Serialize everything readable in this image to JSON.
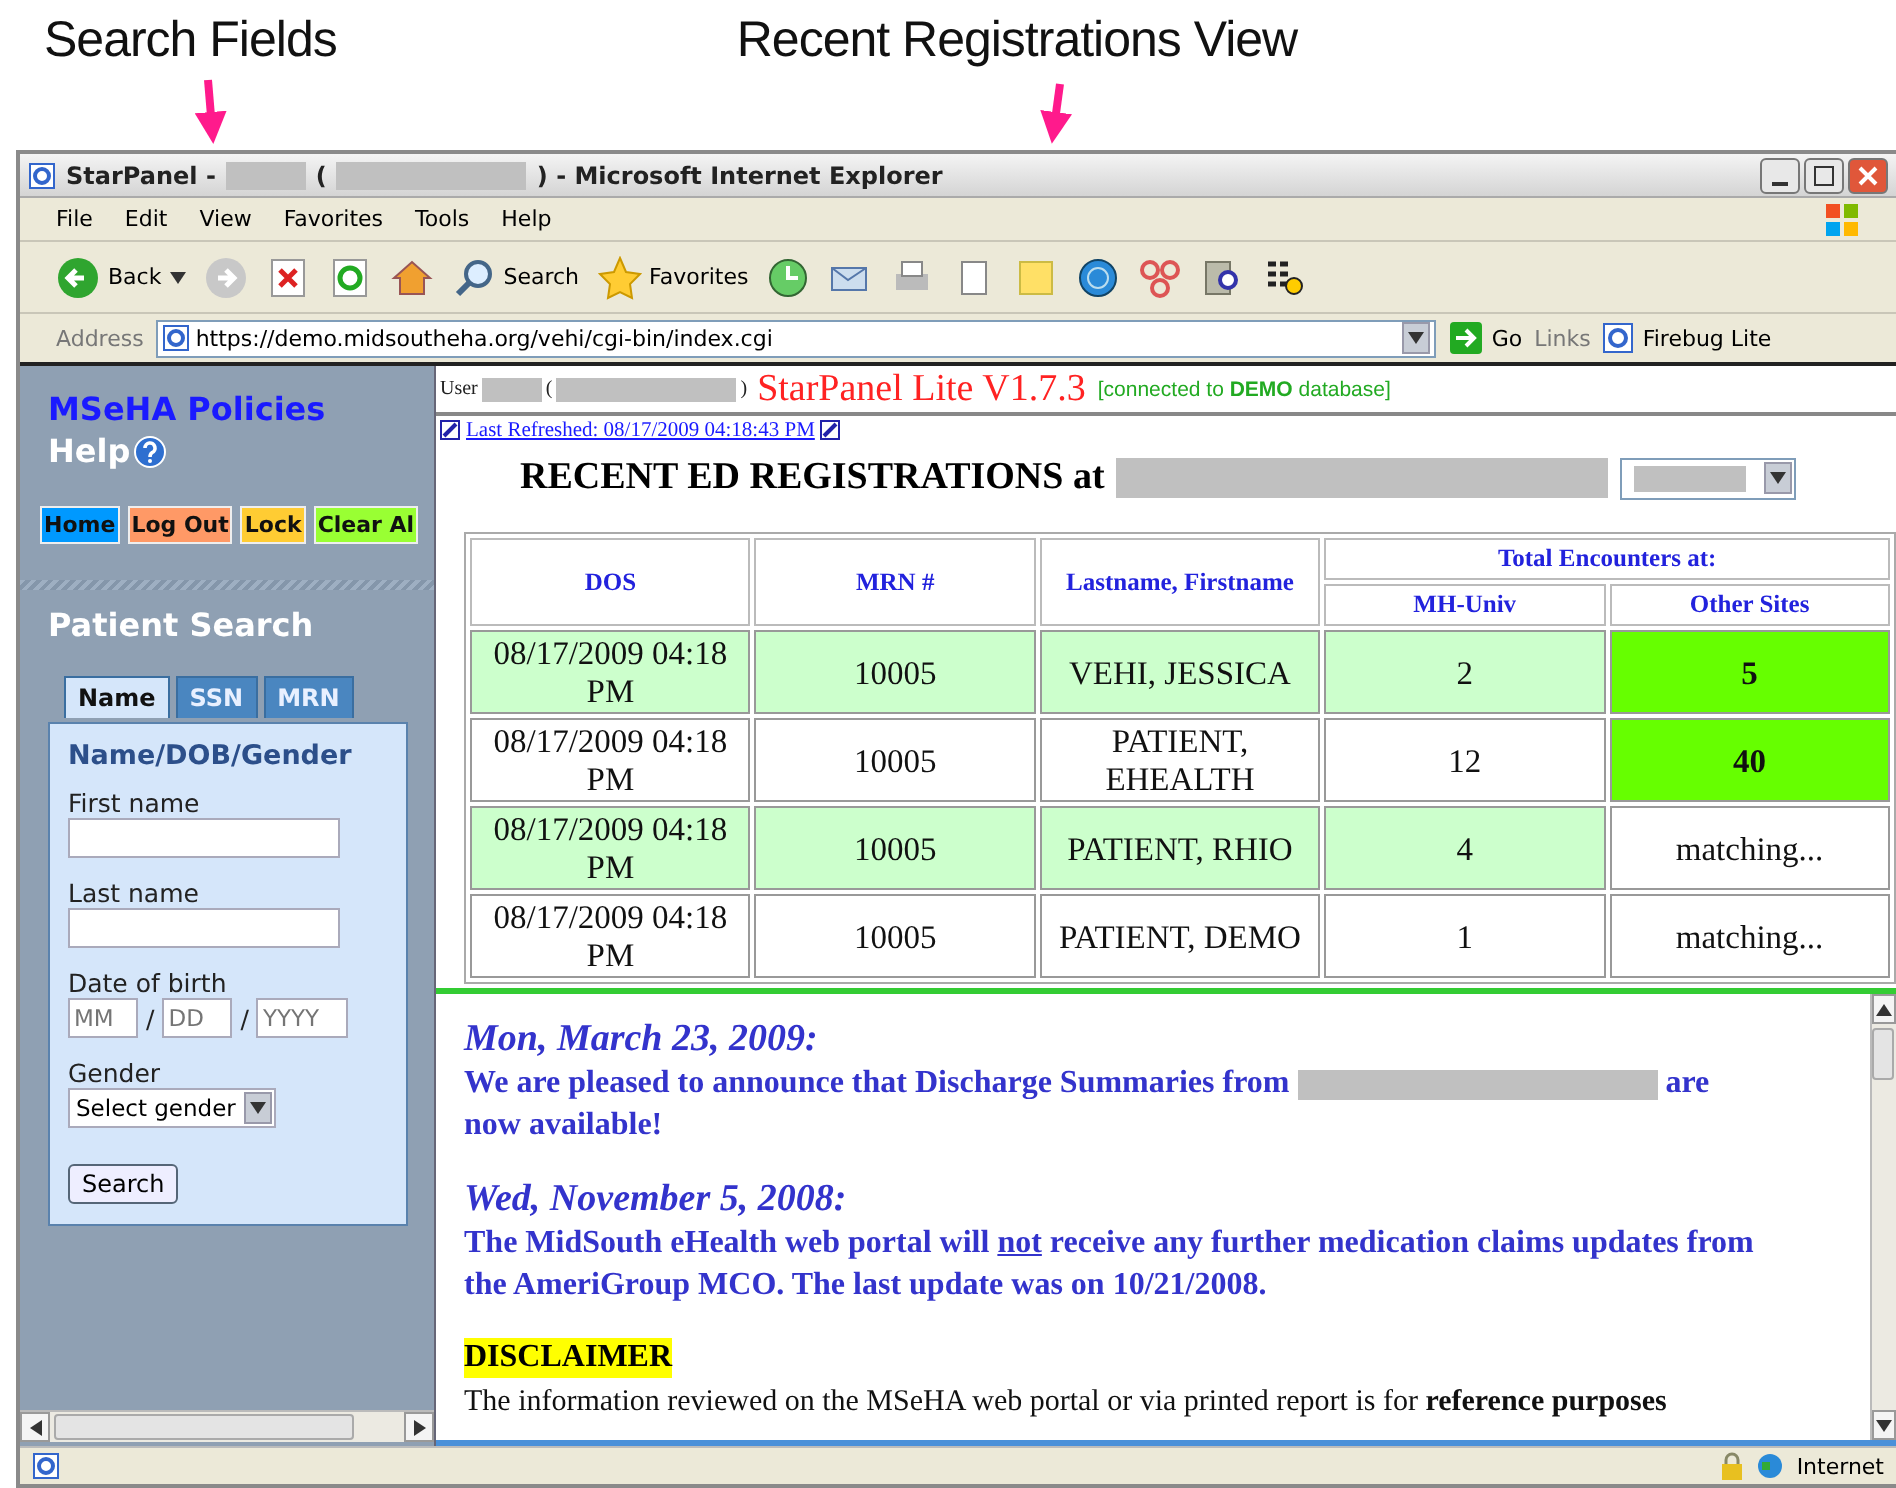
{
  "annotations": [
    {
      "label": "Search Fields"
    },
    {
      "label": "Recent Registrations View"
    }
  ],
  "window": {
    "title_segments": [
      {
        "kind": "text",
        "text": "StarPanel -"
      },
      {
        "kind": "redacted"
      },
      {
        "kind": "text",
        "text": "("
      },
      {
        "kind": "redacted"
      },
      {
        "kind": "text",
        "text": ") - Microsoft Internet Explorer"
      }
    ]
  },
  "menu": [
    "File",
    "Edit",
    "View",
    "Favorites",
    "Tools",
    "Help"
  ],
  "toolbar": {
    "back": "Back",
    "search": "Search",
    "favorites": "Favorites"
  },
  "address_bar": {
    "label": "Address",
    "url": "https://demo.midsoutheha.org/vehi/cgi-bin/index.cgi",
    "go": "Go",
    "links": "Links",
    "link_item": "Firebug Lite"
  },
  "sidebar": {
    "policies": "MSeHA Policies",
    "help": "Help",
    "buttons": [
      {
        "label": "Home",
        "color": "#0099ff"
      },
      {
        "label": "Log Out",
        "color": "#ff9966"
      },
      {
        "label": "Lock",
        "color": "#ffcc33"
      },
      {
        "label": "Clear Al",
        "color": "#99ff33"
      }
    ],
    "search_title": "Patient Search",
    "tabs": [
      {
        "label": "Name",
        "selected": true
      },
      {
        "label": "SSN",
        "selected": false
      },
      {
        "label": "MRN",
        "selected": false
      }
    ],
    "form": {
      "heading": "Name/DOB/Gender",
      "first_name": "First name",
      "last_name": "Last name",
      "dob": "Date of birth",
      "dob_fields": [
        {
          "placeholder": "MM"
        },
        {
          "placeholder": "DD"
        },
        {
          "placeholder": "YYYY"
        }
      ],
      "separators": [
        "/",
        "/"
      ],
      "gender": "Gender",
      "gender_select": "Select gender",
      "search_button": "Search"
    }
  },
  "header": {
    "user": "User",
    "paren_open": "(",
    "paren_close": ")",
    "app": "StarPanel Lite V1.7.3",
    "connected_before": "[connected to ",
    "db": "DEMO",
    "connected_after": " database]",
    "refreshed": "Last Refreshed: 08/17/2009 04:18:43 PM",
    "heading": "RECENT ED REGISTRATIONS at"
  },
  "table": {
    "columns": [
      "DOS",
      "MRN #",
      "Lastname, Firstname"
    ],
    "group_header": "Total Encounters at:",
    "sub_columns": [
      "MH-Univ",
      "Other Sites"
    ],
    "rows": [
      {
        "dos": "08/17/2009 04:18 PM",
        "mrn": "10005",
        "name": "VEHI, JESSICA",
        "mh_univ": "2",
        "other_sites": "5",
        "highlighted": true,
        "other_flagged": true
      },
      {
        "dos": "08/17/2009 04:18 PM",
        "mrn": "10005",
        "name": "PATIENT, EHEALTH",
        "mh_univ": "12",
        "other_sites": "40",
        "highlighted": false,
        "other_flagged": true
      },
      {
        "dos": "08/17/2009 04:18 PM",
        "mrn": "10005",
        "name": "PATIENT, RHIO",
        "mh_univ": "4",
        "other_sites": "matching...",
        "highlighted": true,
        "other_flagged": false
      },
      {
        "dos": "08/17/2009 04:18 PM",
        "mrn": "10005",
        "name": "PATIENT, DEMO",
        "mh_univ": "1",
        "other_sites": "matching...",
        "highlighted": false,
        "other_flagged": false
      }
    ]
  },
  "news": [
    {
      "date": "Mon, March 23, 2009:",
      "segments": [
        {
          "kind": "text",
          "text": "We are pleased to announce that Discharge Summaries from "
        },
        {
          "kind": "redacted"
        },
        {
          "kind": "text",
          "text": " are now available!"
        }
      ]
    },
    {
      "date": "Wed, November 5, 2008:",
      "segments": [
        {
          "kind": "text",
          "text": "The MidSouth eHealth web portal will "
        },
        {
          "kind": "underlined",
          "text": "not"
        },
        {
          "kind": "text",
          "text": " receive any further medication claims updates from the AmeriGroup MCO. The last update was on 10/21/2008."
        }
      ]
    }
  ],
  "disclaimer": {
    "title": "DISCLAIMER",
    "text": "The information reviewed on the MSeHA web portal or via printed report is for **reference purposes**"
  },
  "status_bar": {
    "zone": "Internet"
  }
}
